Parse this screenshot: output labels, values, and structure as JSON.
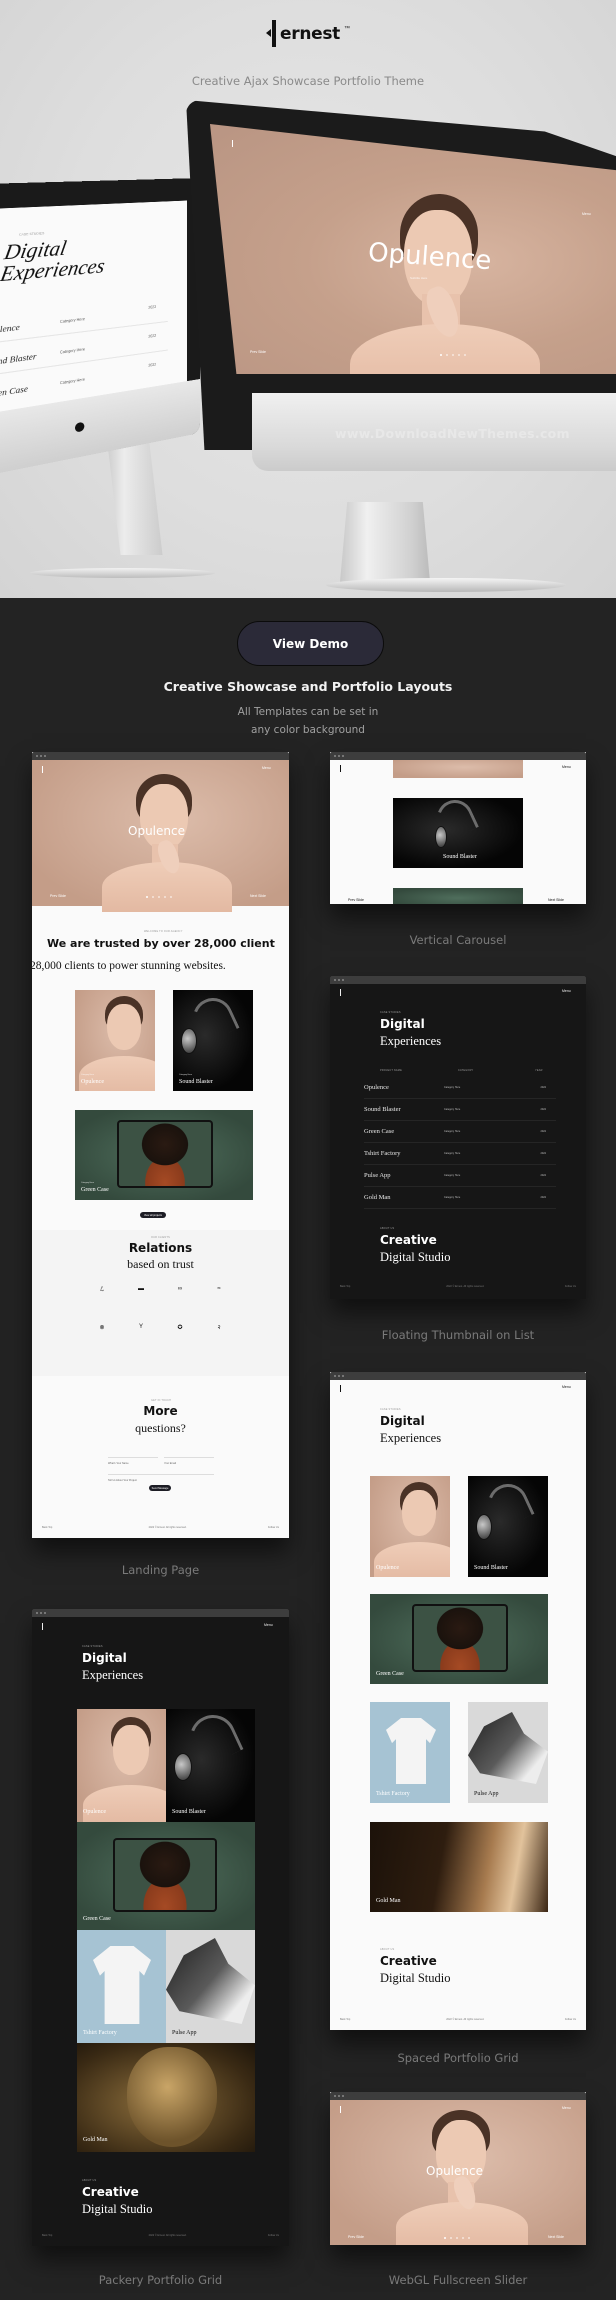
{
  "brand": {
    "name": "ernest",
    "tm": "™",
    "icon": "ernest-bracket-logo"
  },
  "tagline": "Creative Ajax Showcase Portfolio Theme",
  "watermark": "www.DownloadNewThemes.com",
  "hero": {
    "left_monitor": {
      "kicker": "CASE STUDIES",
      "title_line1": "Digital",
      "title_line2": "Experiences",
      "rows": [
        {
          "name": "Opulence",
          "category": "Category Here",
          "year": "2022"
        },
        {
          "name": "Sound Blaster",
          "category": "Category Here",
          "year": "2022"
        },
        {
          "name": "Green Case",
          "category": "Category Here",
          "year": "2022"
        }
      ]
    },
    "right_monitor": {
      "slide_title": "Opulence",
      "slide_subtitle": "Subtitle Here",
      "nav_prev": "Prev Slide",
      "menu": "Menu"
    }
  },
  "cta": {
    "label": "View Demo"
  },
  "section": {
    "title": "Creative Showcase and Portfolio Layouts",
    "subtitle_line1": "All Templates can be set in",
    "subtitle_line2": "any color background"
  },
  "common": {
    "menu": "Menu",
    "category": "Category Here",
    "year": "2022",
    "prev": "Prev Slide",
    "next": "Next Slide",
    "back_top": "Back Top",
    "copyright": "2022 © Ernest. All rights reserved.",
    "follow": "Follow Us",
    "case_studies": "CASE STUDIES",
    "about_us": "ABOUT US",
    "studio_line1": "Creative",
    "studio_line2": "Digital Studio",
    "digital_line1": "Digital",
    "digital_line2": "Experiences"
  },
  "projects": [
    {
      "name": "Opulence"
    },
    {
      "name": "Sound Blaster"
    },
    {
      "name": "Green Case"
    },
    {
      "name": "Tshirt Factory"
    },
    {
      "name": "Pulse App"
    },
    {
      "name": "Gold Man"
    }
  ],
  "landing": {
    "caption": "Landing Page",
    "slide_title": "Opulence",
    "welcome_kicker": "WELCOME TO OUR AGENCY",
    "trusted_sans": "We are trusted by over 28,000 client",
    "trusted_serif": "28,000 clients to power stunning websites.",
    "view_all": "View all projects",
    "clients_kicker": "OUR CLIENTS",
    "relations_line1": "Relations",
    "relations_line2": "based on trust",
    "client_logos": [
      "script-logo",
      "block-logo",
      "infinity-logo",
      "brush-logo",
      "circle-logo",
      "tee-logo",
      "ring-logo",
      "hook-logo"
    ],
    "contact_kicker": "GET IN TOUCH",
    "more_line1": "More",
    "more_line2": "questions?",
    "name_placeholder": "What's Your Name",
    "email_placeholder": "Your Email",
    "project_placeholder": "Tell Us About Your Project",
    "send_label": "Send Message"
  },
  "vertical": {
    "caption": "Vertical Carousel",
    "featured": "Sound Blaster"
  },
  "floating": {
    "caption": "Floating Thumbnail on List",
    "table_headers": [
      "PROJECT NAME",
      "CATEGORY",
      "YEAR"
    ]
  },
  "spaced": {
    "caption": "Spaced Portfolio Grid"
  },
  "packery": {
    "caption": "Packery Portfolio Grid"
  },
  "webgl": {
    "caption": "WebGL Fullscreen Slider",
    "slide_title": "Opulence"
  }
}
